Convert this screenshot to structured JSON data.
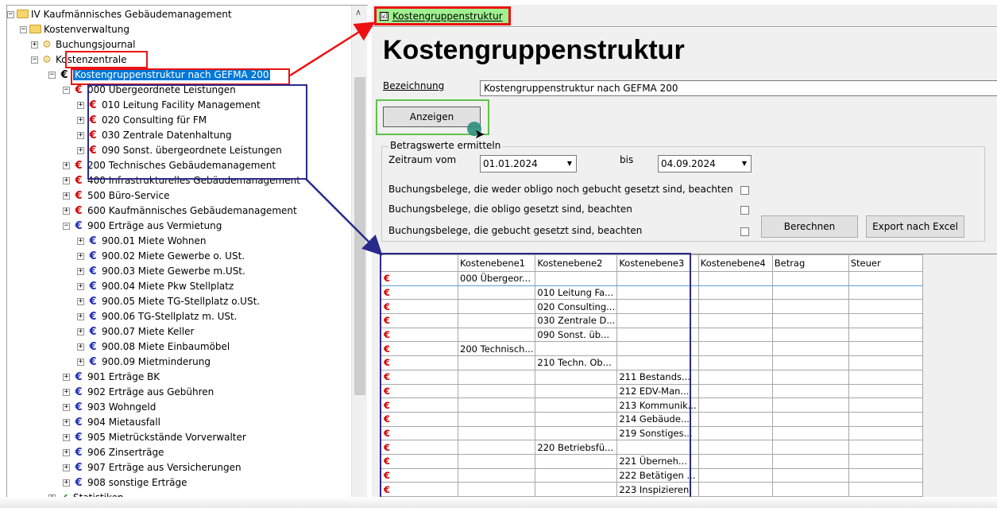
{
  "tree": {
    "items": [
      {
        "label": "IV Kaufmännisches Gebäudemanagement",
        "exp": "−",
        "icon": "folder"
      },
      {
        "label": "Kostenverwaltung",
        "exp": "−",
        "icon": "folder"
      },
      {
        "label": "Buchungsjournal",
        "exp": "+",
        "icon": "cogs"
      },
      {
        "label": "Kostenzentrale",
        "exp": "−",
        "icon": "cogs"
      },
      {
        "label": "Kostengruppenstruktur nach GEFMA 200",
        "exp": "−",
        "icon": "euro-k"
      },
      {
        "label": "000 Übergeordnete Leistungen",
        "exp": "−",
        "icon": "euro-r"
      },
      {
        "label": "010 Leitung Facility Management",
        "exp": "+",
        "icon": "euro-r"
      },
      {
        "label": "020 Consulting für FM",
        "exp": "+",
        "icon": "euro-r"
      },
      {
        "label": "030 Zentrale Datenhaltung",
        "exp": "+",
        "icon": "euro-r"
      },
      {
        "label": "090 Sonst. übergeordnete Leistungen",
        "exp": "+",
        "icon": "euro-r"
      },
      {
        "label": "200 Technisches Gebäudemanagement",
        "exp": "+",
        "icon": "euro-r"
      },
      {
        "label": "400 Infrastrukturelles Gebäudemanagement",
        "exp": "+",
        "icon": "euro-r"
      },
      {
        "label": "500 Büro-Service",
        "exp": "+",
        "icon": "euro-r"
      },
      {
        "label": "600 Kaufmännisches Gebäudemanagement",
        "exp": "+",
        "icon": "euro-r"
      },
      {
        "label": "900 Erträge aus Vermietung",
        "exp": "−",
        "icon": "euro-b"
      },
      {
        "label": "900.01 Miete Wohnen",
        "exp": "+",
        "icon": "euro-b"
      },
      {
        "label": "900.02 Miete Gewerbe o. USt.",
        "exp": "+",
        "icon": "euro-b"
      },
      {
        "label": "900.03 Miete Gewerbe m.USt.",
        "exp": "+",
        "icon": "euro-b"
      },
      {
        "label": "900.04 Miete Pkw Stellplatz",
        "exp": "+",
        "icon": "euro-b"
      },
      {
        "label": "900.05 Miete TG-Stellplatz o.USt.",
        "exp": "+",
        "icon": "euro-b"
      },
      {
        "label": "900.06 TG-Stellplatz m. USt.",
        "exp": "+",
        "icon": "euro-b"
      },
      {
        "label": "900.07 Miete Keller",
        "exp": "+",
        "icon": "euro-b"
      },
      {
        "label": "900.08 Miete Einbaumöbel",
        "exp": "+",
        "icon": "euro-b"
      },
      {
        "label": "900.09 Mietminderung",
        "exp": "+",
        "icon": "euro-b"
      },
      {
        "label": "901 Erträge BK",
        "exp": "+",
        "icon": "euro-b"
      },
      {
        "label": "902 Erträge aus Gebühren",
        "exp": "+",
        "icon": "euro-b"
      },
      {
        "label": "903 Wohngeld",
        "exp": "+",
        "icon": "euro-b"
      },
      {
        "label": "904 Mietausfall",
        "exp": "+",
        "icon": "euro-b"
      },
      {
        "label": "905 Mietrückstände Vorverwalter",
        "exp": "+",
        "icon": "euro-b"
      },
      {
        "label": "906 Zinserträge",
        "exp": "+",
        "icon": "euro-b"
      },
      {
        "label": "907 Erträge aus Versicherungen",
        "exp": "+",
        "icon": "euro-b"
      },
      {
        "label": "908 sonstige Erträge",
        "exp": "+",
        "icon": "euro-b"
      },
      {
        "label": "Statistiken",
        "exp": "+",
        "icon": "check"
      }
    ]
  },
  "tab": {
    "label": "Kostengruppenstruktur",
    "checked": "☑"
  },
  "page": {
    "title": "Kostengruppenstruktur"
  },
  "form": {
    "bezeichnung_label": "Bezeichnung",
    "bezeichnung_value": "Kostengruppenstruktur nach GEFMA 200",
    "anzeigen_button": "Anzeigen",
    "group_title": "Betragswerte ermitteln",
    "zeitraum_label": "Zeitraum vom",
    "date_from": "01.01.2024",
    "bis_label": "bis",
    "date_to": "04.09.2024",
    "opt1": "Buchungsbelege, die weder obligo noch gebucht gesetzt sind, beachten",
    "opt2": "Buchungsbelege, die obligo gesetzt sind, beachten",
    "opt3": "Buchungsbelege, die gebucht gesetzt sind, beachten",
    "berechnen_button": "Berechnen",
    "export_button": "Export nach Excel"
  },
  "grid": {
    "headers": [
      "",
      "Kostenebene1",
      "Kostenebene2",
      "Kostenebene3",
      "Kostenebene4",
      "Betrag",
      "Steuer"
    ],
    "row_icon": "€",
    "rows": [
      [
        "000 Übergeor...",
        "",
        "",
        ""
      ],
      [
        "",
        "010 Leitung Fa...",
        "",
        ""
      ],
      [
        "",
        "020 Consulting...",
        "",
        ""
      ],
      [
        "",
        "030 Zentrale D...",
        "",
        ""
      ],
      [
        "",
        "090 Sonst. üb...",
        "",
        ""
      ],
      [
        "200 Technisch...",
        "",
        "",
        ""
      ],
      [
        "",
        "210 Techn. Ob...",
        "",
        ""
      ],
      [
        "",
        "",
        "211 Bestands...",
        ""
      ],
      [
        "",
        "",
        "212 EDV-Man...",
        ""
      ],
      [
        "",
        "",
        "213 Kommunik...",
        ""
      ],
      [
        "",
        "",
        "214 Gebäude...",
        ""
      ],
      [
        "",
        "",
        "219 Sonstiges...",
        ""
      ],
      [
        "",
        "220 Betriebsfü...",
        "",
        ""
      ],
      [
        "",
        "",
        "221 Überneh...",
        ""
      ],
      [
        "",
        "",
        "222 Betätigen ...",
        ""
      ],
      [
        "",
        "",
        "223 Inspizieren",
        ""
      ]
    ]
  },
  "colors": {
    "accent_red": "#e11111",
    "accent_blue": "#2a2a8a",
    "accent_green": "#5fc24a",
    "selection": "#0078d7"
  }
}
